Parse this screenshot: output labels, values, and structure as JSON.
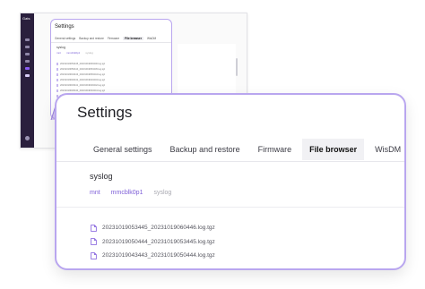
{
  "background_screenshot": {
    "logo_text": "Gats",
    "title": "Settings",
    "tabs": [
      "General settings",
      "Backup and restore",
      "Firmware",
      "File browser",
      "WisDM"
    ],
    "active_tab": "File browser",
    "path_label": "syslog",
    "crumbs": [
      "mnt",
      "mmcblk0p1",
      "syslog"
    ],
    "files": [
      "20231019053445_20231019060446.log.tgz",
      "20231019050444_20231019053445.log.tgz",
      "20231019043443_20231019050444.log.tgz",
      "20231019040442_20231019043443.log.tgz",
      "20231019033441_20231019040442.log.tgz",
      "20231019030440_20231019033441.log.tgz",
      "20231019023439_20231019030440.log.tgz"
    ]
  },
  "zoom_panel": {
    "title": "Settings",
    "tabs": [
      {
        "label": "General settings",
        "active": false
      },
      {
        "label": "Backup and restore",
        "active": false
      },
      {
        "label": "Firmware",
        "active": false
      },
      {
        "label": "File browser",
        "active": true
      },
      {
        "label": "WisDM",
        "active": false
      }
    ],
    "path_label": "syslog",
    "crumbs": [
      {
        "label": "mnt",
        "current": false
      },
      {
        "label": "mmcblk0p1",
        "current": false
      },
      {
        "label": "syslog",
        "current": true
      }
    ],
    "files": [
      "20231019053445_20231019060446.log.tgz",
      "20231019050444_20231019053445.log.tgz",
      "20231019043443_20231019050444.log.tgz"
    ]
  },
  "colors": {
    "accent": "#7e5fd8",
    "accent_border": "#b9a6ef",
    "sidebar": "#2a1f3d",
    "connector_fill": "#b39ae8"
  },
  "icons": {
    "file": "file-icon"
  }
}
